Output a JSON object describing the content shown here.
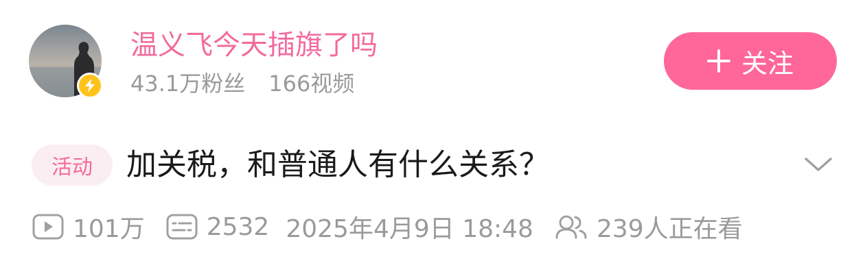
{
  "uploader": {
    "name": "温义飞今天插旗了吗",
    "followers": "43.1万粉丝",
    "videos": "166视频",
    "avatar_icon": "avatar-person-silhouette",
    "badge_icon": "lightning-bolt-icon",
    "badge_color": "#ffc21a"
  },
  "follow_button": {
    "label": "关注",
    "icon": "plus-icon",
    "color": "#ff6699"
  },
  "title": {
    "tag": "活动",
    "text": "加关税，和普通人有什么关系？",
    "expand_icon": "chevron-down-icon"
  },
  "meta": {
    "views": "101万",
    "danmaku": "2532",
    "date": "2025年4月9日 18:48",
    "watching": "239人正在看"
  },
  "colors": {
    "accent": "#ff6699",
    "name": "#f26b9c",
    "secondary_text": "#9a9a9a",
    "title_text": "#1a1a1a"
  }
}
